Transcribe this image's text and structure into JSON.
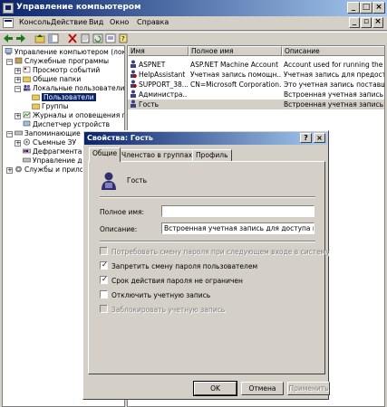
{
  "window": {
    "title": "Управление компьютером"
  },
  "menu": [
    "Консоль",
    "Действие",
    "Вид",
    "Окно",
    "Справка"
  ],
  "tree": {
    "root": "Управление компьютером (локаль",
    "nodes": [
      "Служебные программы",
      "Просмотр событий",
      "Общие папки",
      "Локальные пользователи",
      "Пользователи",
      "Группы",
      "Журналы и оповещения пр",
      "Диспетчер устройств",
      "Запоминающие ус",
      "Съемные ЗУ",
      "Дефрагмента",
      "Управление д",
      "Службы и прилож"
    ]
  },
  "list": {
    "columns": [
      "Имя",
      "Полное имя",
      "Описание"
    ],
    "rows": [
      {
        "name": "ASPNET",
        "full": "ASP.NET Machine Account",
        "desc": "Account used for running the ASP.N"
      },
      {
        "name": "HelpAssistant",
        "full": "Учетная запись помощн...",
        "desc": "Учетная запись для предоставлен"
      },
      {
        "name": "SUPPORT_38...",
        "full": "CN=Microsoft Corporation...",
        "desc": "Это учетная запись поставщика"
      },
      {
        "name": "Администра...",
        "full": "",
        "desc": "Встроенная учетная запись для а"
      },
      {
        "name": "Гость",
        "full": "",
        "desc": "Встроенная учетная запись для д"
      }
    ]
  },
  "dialog": {
    "title": "Свойства: Гость",
    "help_btn": "?",
    "close_btn": "×",
    "tabs": [
      "Общие",
      "Членство в группах",
      "Профиль"
    ],
    "username": "Гость",
    "fullname_label": "Полное имя:",
    "fullname_value": "",
    "desc_label": "Описание:",
    "desc_value": "Встроенная учетная запись для доступа гостей",
    "checkboxes": [
      {
        "label": "Потребовать смену пароля при следующем входе в систему",
        "checked": false,
        "disabled": true
      },
      {
        "label": "Запретить смену пароля пользователем",
        "checked": true,
        "disabled": false
      },
      {
        "label": "Срок действия пароля не ограничен",
        "checked": true,
        "disabled": false
      },
      {
        "label": "Отключить учетную запись",
        "checked": false,
        "disabled": false
      },
      {
        "label": "Заблокировать учетную запись",
        "checked": false,
        "disabled": true
      }
    ],
    "buttons": {
      "ok": "OK",
      "cancel": "Отмена",
      "apply": "Применить"
    }
  }
}
